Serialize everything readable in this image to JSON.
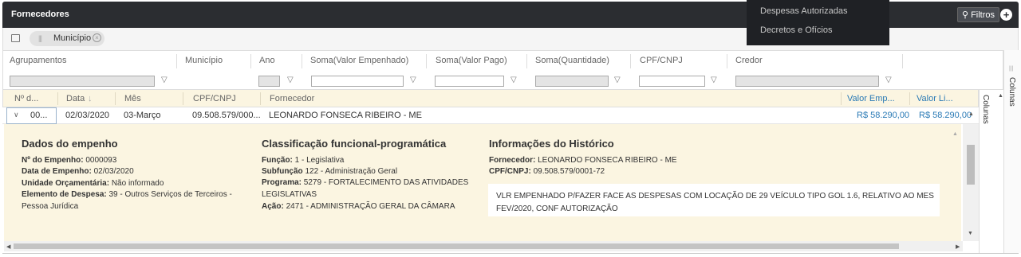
{
  "header": {
    "title": "Fornecedores",
    "filtros_label": "Filtros"
  },
  "dropdown": {
    "items": [
      "Despesas Autorizadas",
      "Decretos e Ofícios"
    ]
  },
  "chips": {
    "municipio": "Município"
  },
  "pivot": {
    "headers": [
      "Agrupamentos",
      "Município",
      "Ano",
      "Soma(Valor Empenhado)",
      "Soma(Valor Pago)",
      "Soma(Quantidade)",
      "CPF/CNPJ",
      "Credor"
    ]
  },
  "side": {
    "colunas": "Colunas"
  },
  "grid": {
    "headers": [
      "Nº d...",
      "Data",
      "Mês",
      "CPF/CNPJ",
      "Fornecedor",
      "Valor Emp...",
      "Valor Li..."
    ],
    "row": {
      "num": "00...",
      "data": "02/03/2020",
      "mes": "03-Março",
      "cpf": "09.508.579/000...",
      "fornecedor": "LEONARDO FONSECA RIBEIRO - ME",
      "valor_emp": "R$ 58.290,00",
      "valor_li": "R$ 58.290,00"
    }
  },
  "detail": {
    "empenho": {
      "title": "Dados do empenho",
      "num_label": "Nº do Empenho:",
      "num": "0000093",
      "data_label": "Data de Empenho:",
      "data": "02/03/2020",
      "unidade_label": "Unidade Orçamentária:",
      "unidade": "Não informado",
      "elemento_label": "Elemento de Despesa:",
      "elemento": "39 - Outros Serviços de Terceiros -",
      "elemento2": "Pessoa Jurídica"
    },
    "classificacao": {
      "title": "Classificação funcional-programática",
      "funcao_label": "Função:",
      "funcao": "1 - Legislativa",
      "subfuncao_label": "Subfunção",
      "subfuncao": "122 - Administração Geral",
      "programa_label": "Programa:",
      "programa": "5279 - FORTALECIMENTO DAS ATIVIDADES",
      "programa2": "LEGISLATIVAS",
      "acao_label": "Ação:",
      "acao": "2471 - ADMINISTRAÇÃO GERAL DA CÂMARA"
    },
    "historico": {
      "title": "Informações do Histórico",
      "fornecedor_label": "Fornecedor:",
      "fornecedor": "LEONARDO FONSECA RIBEIRO - ME",
      "cpf_label": "CPF/CNPJ:",
      "cpf": "09.508.579/0001-72",
      "texto": "VLR EMPENHADO P/FAZER FACE AS DESPESAS COM LOCAÇÃO DE 29 VEÍCULO TIPO GOL 1.6, RELATIVO AO MES FEV/2020, CONF AUTORIZAÇÃO"
    }
  }
}
